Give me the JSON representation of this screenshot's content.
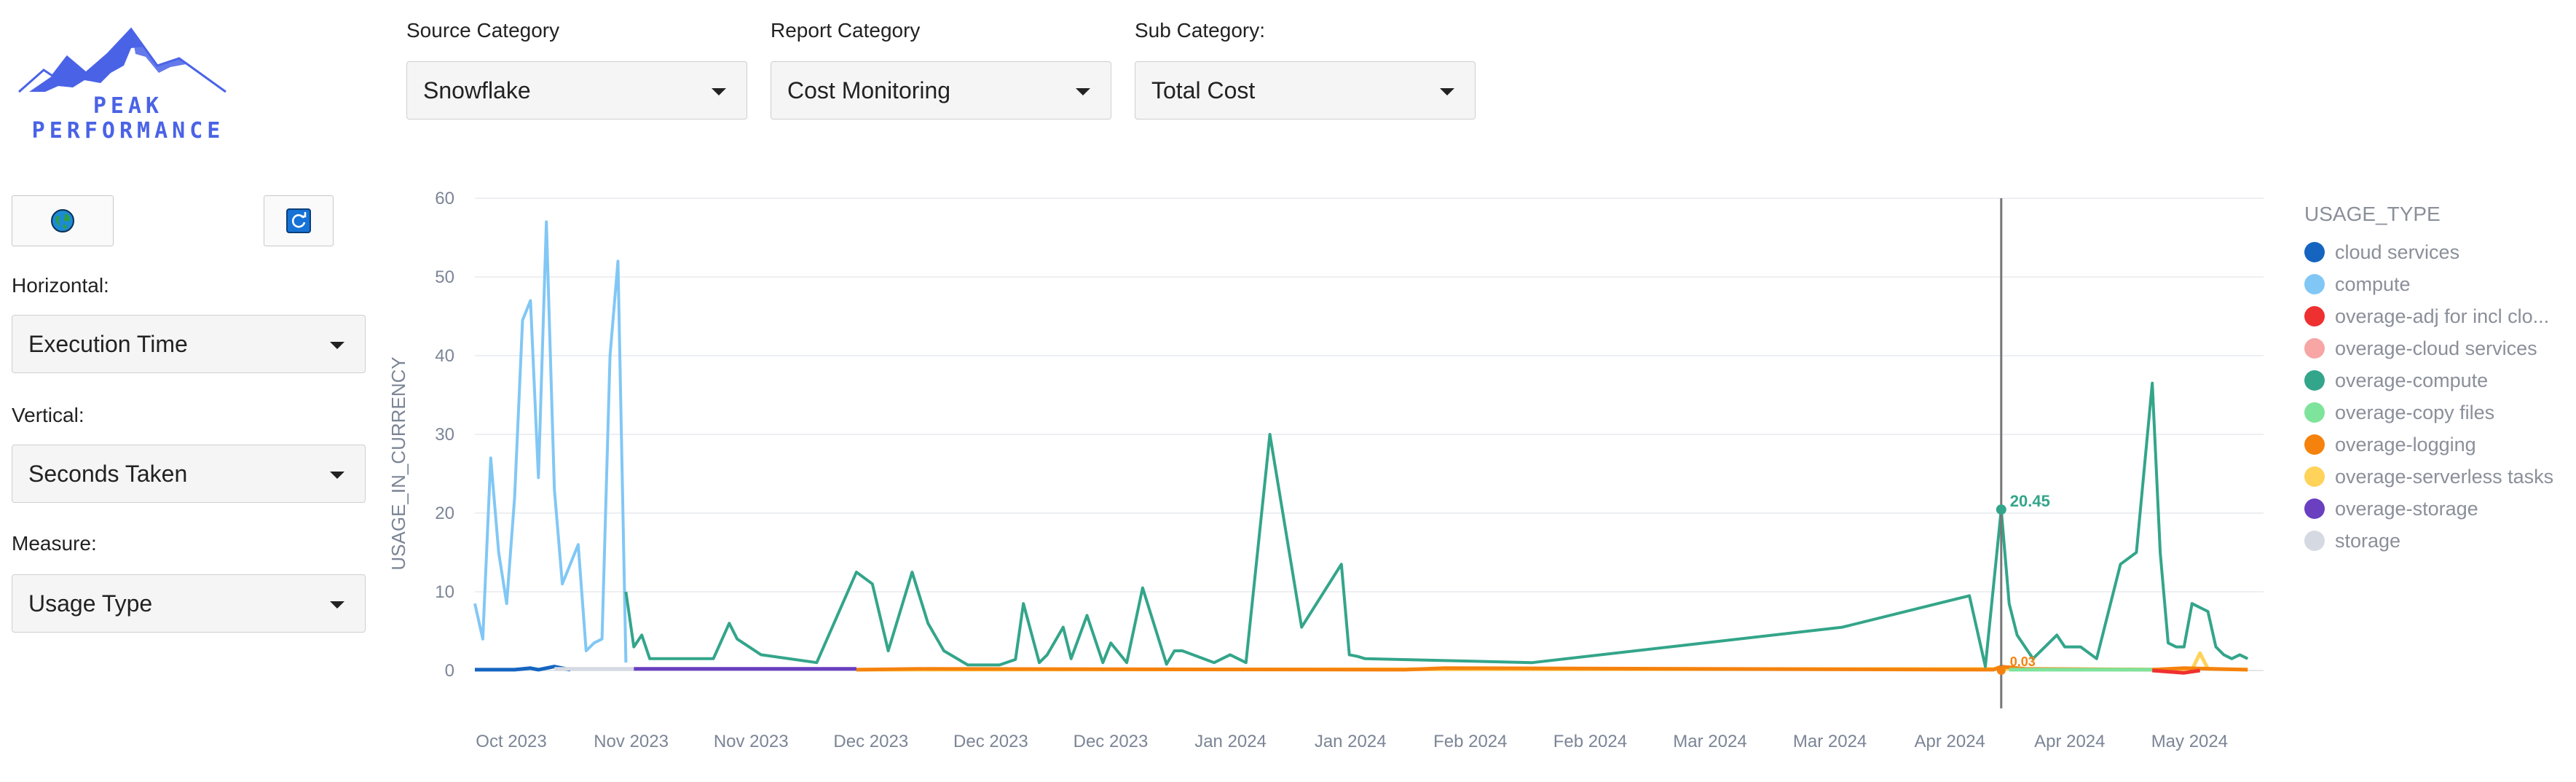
{
  "logo": {
    "line1": "PEAK",
    "line2": "PERFORMANCE"
  },
  "buttons": {
    "globe_icon": "globe-icon",
    "refresh_icon": "refresh-icon"
  },
  "sidebar": {
    "horizontal_label": "Horizontal:",
    "horizontal_value": "Execution Time",
    "vertical_label": "Vertical:",
    "vertical_value": "Seconds Taken",
    "measure_label": "Measure:",
    "measure_value": "Usage Type"
  },
  "filters": {
    "source_label": "Source Category",
    "source_value": "Snowflake",
    "report_label": "Report Category",
    "report_value": "Cost Monitoring",
    "sub_label": "Sub Category:",
    "sub_value": "Total Cost"
  },
  "colors": {
    "cloud services": "#1565c0",
    "compute": "#81c7f5",
    "overage-adj for incl clo...": "#ef3030",
    "overage-cloud services": "#f7a5a5",
    "overage-compute": "#33a58a",
    "overage-copy files": "#7ee49c",
    "overage-logging": "#f5820d",
    "overage-serverless tasks": "#ffd25a",
    "overage-storage": "#6a3fc0",
    "storage": "#d5d9e2",
    "hover_line": "#777777"
  },
  "chart_data": {
    "type": "line",
    "ylabel": "USAGE_IN_CURRENCY",
    "ylim": [
      0,
      60
    ],
    "yticks": [
      0,
      10,
      20,
      30,
      40,
      50,
      60
    ],
    "xtick_labels": [
      "Oct 2023",
      "Nov 2023",
      "Nov 2023",
      "Dec 2023",
      "Dec 2023",
      "Dec 2023",
      "Jan 2024",
      "Jan 2024",
      "Feb 2024",
      "Feb 2024",
      "Mar 2024",
      "Mar 2024",
      "Apr 2024",
      "Apr 2024",
      "May 2024"
    ],
    "legend_title": "USAGE_TYPE",
    "legend_position": "right",
    "grid": true,
    "hover": {
      "date": "2024-04-09",
      "value": 20.45,
      "label": "20.45",
      "small_label": "0.03"
    },
    "series": [
      {
        "name": "compute",
        "x": [
          "2023-09-30",
          "2023-10-01",
          "2023-10-02",
          "2023-10-03",
          "2023-10-04",
          "2023-10-05",
          "2023-10-06",
          "2023-10-07",
          "2023-10-08",
          "2023-10-09",
          "2023-10-10",
          "2023-10-11",
          "2023-10-12",
          "2023-10-13",
          "2023-10-14",
          "2023-10-15",
          "2023-10-16",
          "2023-10-17",
          "2023-10-18",
          "2023-10-19"
        ],
        "y": [
          8.5,
          4,
          27,
          15,
          8.5,
          22,
          44.5,
          47,
          24.5,
          57,
          23,
          11,
          13.5,
          16,
          2.5,
          3.5,
          4,
          40,
          52,
          1
        ]
      },
      {
        "name": "overage-compute",
        "x": [
          "2023-10-19",
          "2023-10-20",
          "2023-10-21",
          "2023-10-22",
          "2023-10-25",
          "2023-10-30",
          "2023-11-01",
          "2023-11-02",
          "2023-11-05",
          "2023-11-12",
          "2023-11-17",
          "2023-11-19",
          "2023-11-21",
          "2023-11-24",
          "2023-11-26",
          "2023-11-28",
          "2023-12-01",
          "2023-12-05",
          "2023-12-07",
          "2023-12-08",
          "2023-12-10",
          "2023-12-11",
          "2023-12-13",
          "2023-12-14",
          "2023-12-16",
          "2023-12-18",
          "2023-12-19",
          "2023-12-21",
          "2023-12-23",
          "2023-12-26",
          "2023-12-27",
          "2023-12-28",
          "2024-01-01",
          "2024-01-03",
          "2024-01-05",
          "2024-01-08",
          "2024-01-12",
          "2024-01-17",
          "2024-01-18",
          "2024-01-19",
          "2024-01-20",
          "2024-02-10",
          "2024-03-20",
          "2024-04-05",
          "2024-04-07",
          "2024-04-09",
          "2024-04-10",
          "2024-04-11",
          "2024-04-13",
          "2024-04-16",
          "2024-04-17",
          "2024-04-19",
          "2024-04-21",
          "2024-04-24",
          "2024-04-26",
          "2024-04-28",
          "2024-04-29",
          "2024-04-30",
          "2024-05-01",
          "2024-05-02",
          "2024-05-03",
          "2024-05-05",
          "2024-05-06",
          "2024-05-07",
          "2024-05-08",
          "2024-05-09",
          "2024-05-10"
        ],
        "y": [
          10,
          3,
          4.5,
          1.5,
          1.5,
          1.5,
          6,
          4,
          2,
          1,
          12.5,
          11,
          2.5,
          12.5,
          6,
          2.5,
          0.7,
          0.7,
          1.4,
          8.5,
          1,
          2,
          5.5,
          1.5,
          7,
          1,
          3.5,
          1,
          10.5,
          0.8,
          2.5,
          2.5,
          1,
          2,
          1,
          30,
          5.5,
          13.5,
          2,
          1.8,
          1.5,
          1,
          5.5,
          9.5,
          0.5,
          20.45,
          8.5,
          4.5,
          1.5,
          4.5,
          3,
          3,
          1.5,
          13.5,
          15,
          36.5,
          15,
          3.5,
          3,
          3,
          8.5,
          7.5,
          3,
          2,
          1.5,
          2,
          1.5
        ]
      },
      {
        "name": "cloud services",
        "x": [
          "2023-09-30",
          "2023-10-05",
          "2023-10-07",
          "2023-10-08",
          "2023-10-10",
          "2023-10-12"
        ],
        "y": [
          0.1,
          0.1,
          0.3,
          0.1,
          0.5,
          0.1
        ]
      },
      {
        "name": "storage",
        "x": [
          "2023-10-10",
          "2023-10-20"
        ],
        "y": [
          0.2,
          0.2
        ]
      },
      {
        "name": "overage-storage",
        "x": [
          "2023-10-20",
          "2023-11-17"
        ],
        "y": [
          0.2,
          0.2
        ]
      },
      {
        "name": "overage-serverless tasks",
        "x": [
          "2023-11-17",
          "2024-04-08",
          "2024-05-03",
          "2024-05-04",
          "2024-05-05",
          "2024-05-10"
        ],
        "y": [
          0.1,
          0.2,
          0.1,
          2.2,
          0.2,
          0.1
        ]
      },
      {
        "name": "overage-logging",
        "x": [
          "2023-11-17",
          "2023-11-25",
          "2024-01-25",
          "2024-01-30",
          "2024-04-08",
          "2024-04-09",
          "2024-04-12",
          "2024-04-28",
          "2024-05-02",
          "2024-05-10"
        ],
        "y": [
          0.1,
          0.2,
          0.1,
          0.3,
          0.1,
          0.5,
          0.2,
          0.1,
          0.3,
          0.1
        ]
      },
      {
        "name": "overage-copy files",
        "x": [
          "2024-04-10",
          "2024-04-28"
        ],
        "y": [
          0.1,
          0.1
        ]
      },
      {
        "name": "overage-adj for incl clo...",
        "x": [
          "2024-04-28",
          "2024-05-02",
          "2024-05-04"
        ],
        "y": [
          0.0,
          -0.3,
          0.0
        ]
      }
    ],
    "legend": [
      "cloud services",
      "compute",
      "overage-adj for incl clo...",
      "overage-cloud services",
      "overage-compute",
      "overage-copy files",
      "overage-logging",
      "overage-serverless tasks",
      "overage-storage",
      "storage"
    ]
  }
}
